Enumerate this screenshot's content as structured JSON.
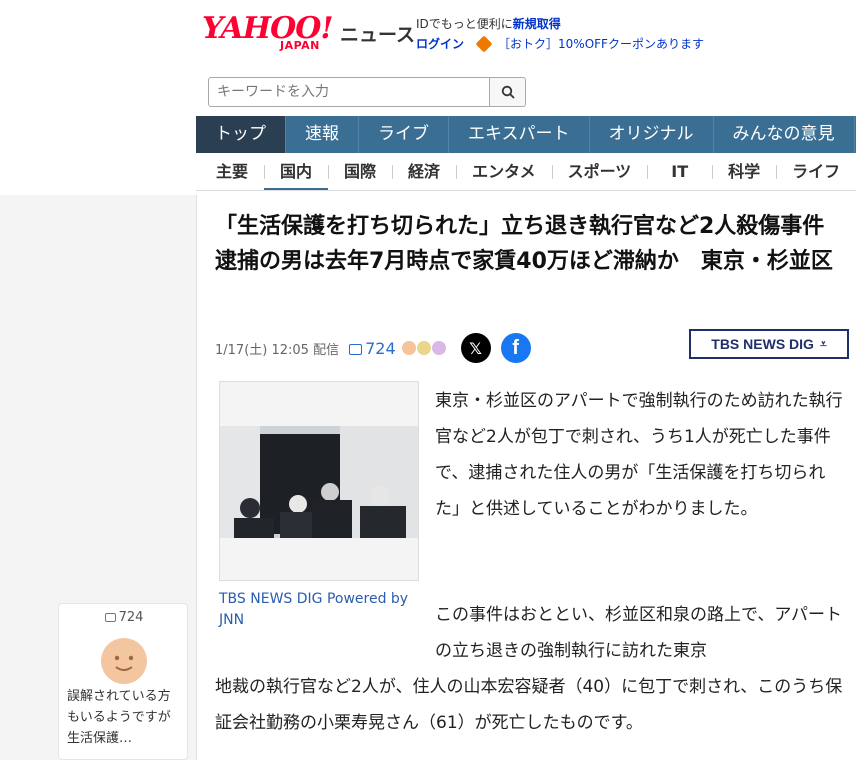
{
  "header": {
    "logo_main": "YAHOO!",
    "logo_sub": "JAPAN",
    "logo_news": "ニュース",
    "login_prompt": "IDでもっと便利に",
    "register_link": "新規取得",
    "login_link": "ログイン",
    "coupon_text": "［おトク］10%OFFクーポンあります"
  },
  "search": {
    "placeholder": "キーワードを入力"
  },
  "nav_primary": [
    "トップ",
    "速報",
    "ライブ",
    "エキスパート",
    "オリジナル",
    "みんなの意見"
  ],
  "nav_secondary": [
    "主要",
    "国内",
    "国際",
    "経済",
    "エンタメ",
    "スポーツ",
    "IT",
    "科学",
    "ライフ"
  ],
  "article": {
    "title": "「生活保護を打ち切られた」立ち退き執行官など2人殺傷事件　逮捕の男は去年7月時点で家賃40万ほど滞納か　東京・杉並区",
    "date": "1/17(土) 12:05 配信",
    "comment_count": "724",
    "source_logo": "TBS NEWS DIG",
    "photo_caption": "TBS NEWS DIG Powered by JNN",
    "paragraph1": "東京・杉並区のアパートで強制執行のため訪れた執行官など2人が包丁で刺され、うち1人が死亡した事件で、逮捕された住人の男が「生活保護を打ち切られた」と供述していることがわかりました。",
    "paragraph2a": "この事件はおととい、杉並区和泉の路上で、アパートの立ち退きの強制執行に訪れた東京",
    "paragraph2b": "地裁の執行官など2人が、住人の山本宏容疑者（40）に包丁で刺され、このうち保証会社勤務の小栗寿晃さん（61）が死亡したものです。"
  },
  "comment_card": {
    "count": "724",
    "text": "誤解されている方もいるようですが 生活保護…"
  },
  "colors": {
    "brand_red": "#ff0033",
    "nav_blue": "#3a6f93",
    "nav_active": "#2b3f53",
    "link_blue": "#2a6ccc"
  }
}
